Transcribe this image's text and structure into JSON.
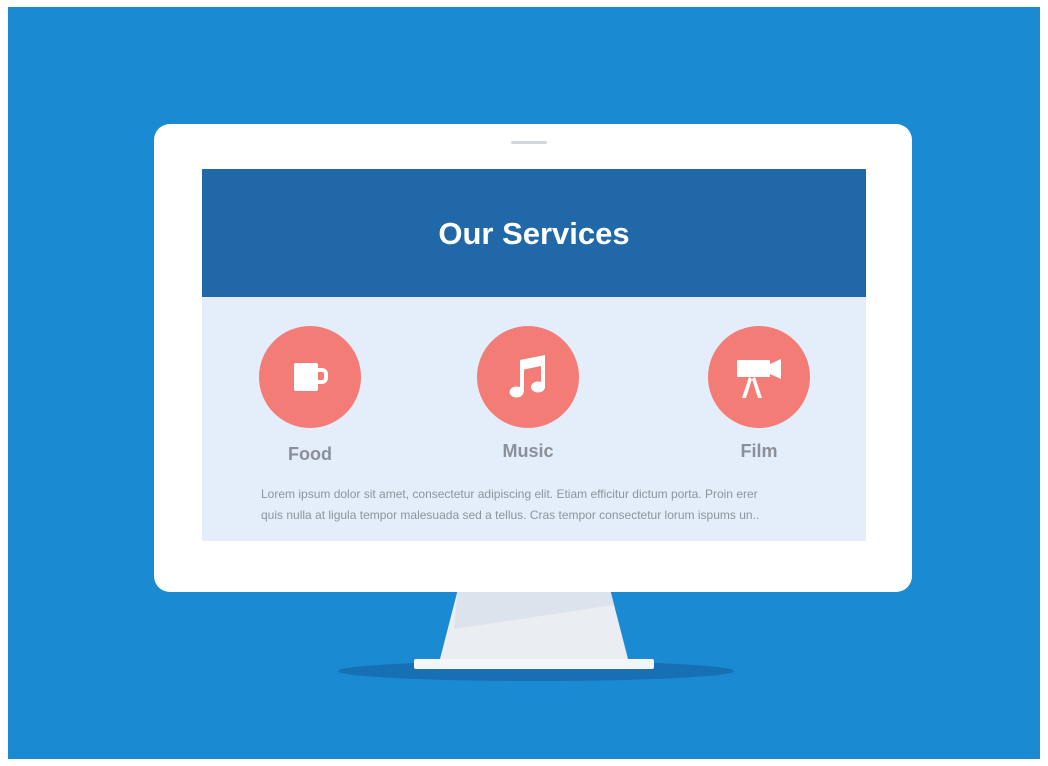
{
  "page": {
    "title": "Our Services"
  },
  "services": [
    {
      "label": "Food",
      "icon": "coffee-mug-icon"
    },
    {
      "label": "Music",
      "icon": "music-note-icon"
    },
    {
      "label": "Film",
      "icon": "film-camera-icon"
    }
  ],
  "description": {
    "line1": "Lorem ipsum dolor sit amet, consectetur adipiscing elit. Etiam efficitur dictum porta. Proin erer",
    "line2": "quis nulla at ligula tempor malesuada sed a tellus. Cras tempor consectetur lorum ispums un.."
  },
  "colors": {
    "background": "#1a8ad2",
    "header": "#2068a7",
    "screen": "#e3eefa",
    "accent": "#f47c76",
    "label": "#8b9098"
  }
}
